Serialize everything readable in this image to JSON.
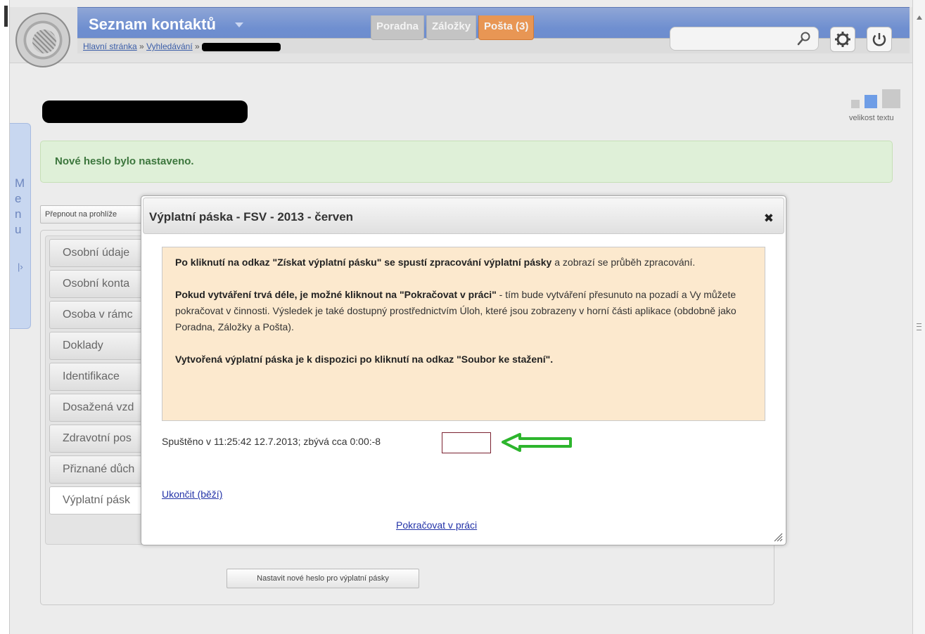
{
  "header": {
    "app_title": "Seznam kontaktů",
    "breadcrumb": {
      "home": "Hlavní stránka",
      "sep": "»",
      "search": "Vyhledávání"
    },
    "tabs": [
      {
        "label": "Poradna"
      },
      {
        "label": "Záložky"
      },
      {
        "label": "Pošta (3)"
      }
    ],
    "search": {
      "value": "",
      "placeholder": ""
    },
    "icons": {
      "search": "search-icon",
      "settings": "gear-icon",
      "power": "power-icon"
    },
    "colors": {
      "bar": "#6f8fd0",
      "mail_tab": "#e89654",
      "inactive_tab": "#c4c4c4"
    }
  },
  "side_menu": {
    "letters": [
      "M",
      "e",
      "n",
      "u"
    ],
    "pin_icon": "pin-icon"
  },
  "text_size": {
    "label": "velikost textu",
    "selected": "medium"
  },
  "alert": {
    "message": "Nové heslo bylo nastaveno.",
    "color": "#3c763d"
  },
  "switch_button": {
    "label": "Přepnout na prohlíže"
  },
  "vertical_tabs": [
    {
      "label": "Osobní údaje"
    },
    {
      "label": "Osobní konta"
    },
    {
      "label": "Osoba v rámc"
    },
    {
      "label": "Doklady"
    },
    {
      "label": "Identifikace"
    },
    {
      "label": "Dosažená vzd"
    },
    {
      "label": "Zdravotní pos"
    },
    {
      "label": "Přiznané důch"
    },
    {
      "label": "Výplatní pásk"
    }
  ],
  "set_password_button": {
    "label": "Nastavit nové heslo pro výplatní pásky"
  },
  "dialog": {
    "title": "Výplatní páska - FSV - 2013 - červen",
    "close": "✖",
    "info": {
      "p1_bold": "Po kliknutí na odkaz \"Získat výplatní pásku\" se spustí zpracování výplatní pásky",
      "p1_rest": " a zobrazí se průběh zpracování.",
      "p2_bold": "Pokud vytváření trvá déle, je možné kliknout na \"Pokračovat v práci\"",
      "p2_rest": " - tím bude vytváření přesunuto na pozadí a Vy můžete pokračovat v činnosti. Výsledek je také dostupný prostřednictvím Úloh, které jsou zobrazeny v horní části aplikace (obdobně jako Poradna, Záložky a Pošta).",
      "p3_bold": "Vytvořená výplatní páska je k dispozici po kliknutí na odkaz \"Soubor ke stažení\"."
    },
    "status": "Spuštěno v 11:25:42 12.7.2013; zbývá cca 0:00:-8",
    "stop_link": "Ukončit (běží)",
    "continue_link": "Pokračovat v práci",
    "colors": {
      "info_bg": "#fce9ce",
      "link": "#2333a8",
      "arrow": "#2db52d",
      "progress_border": "#7a2130"
    }
  }
}
